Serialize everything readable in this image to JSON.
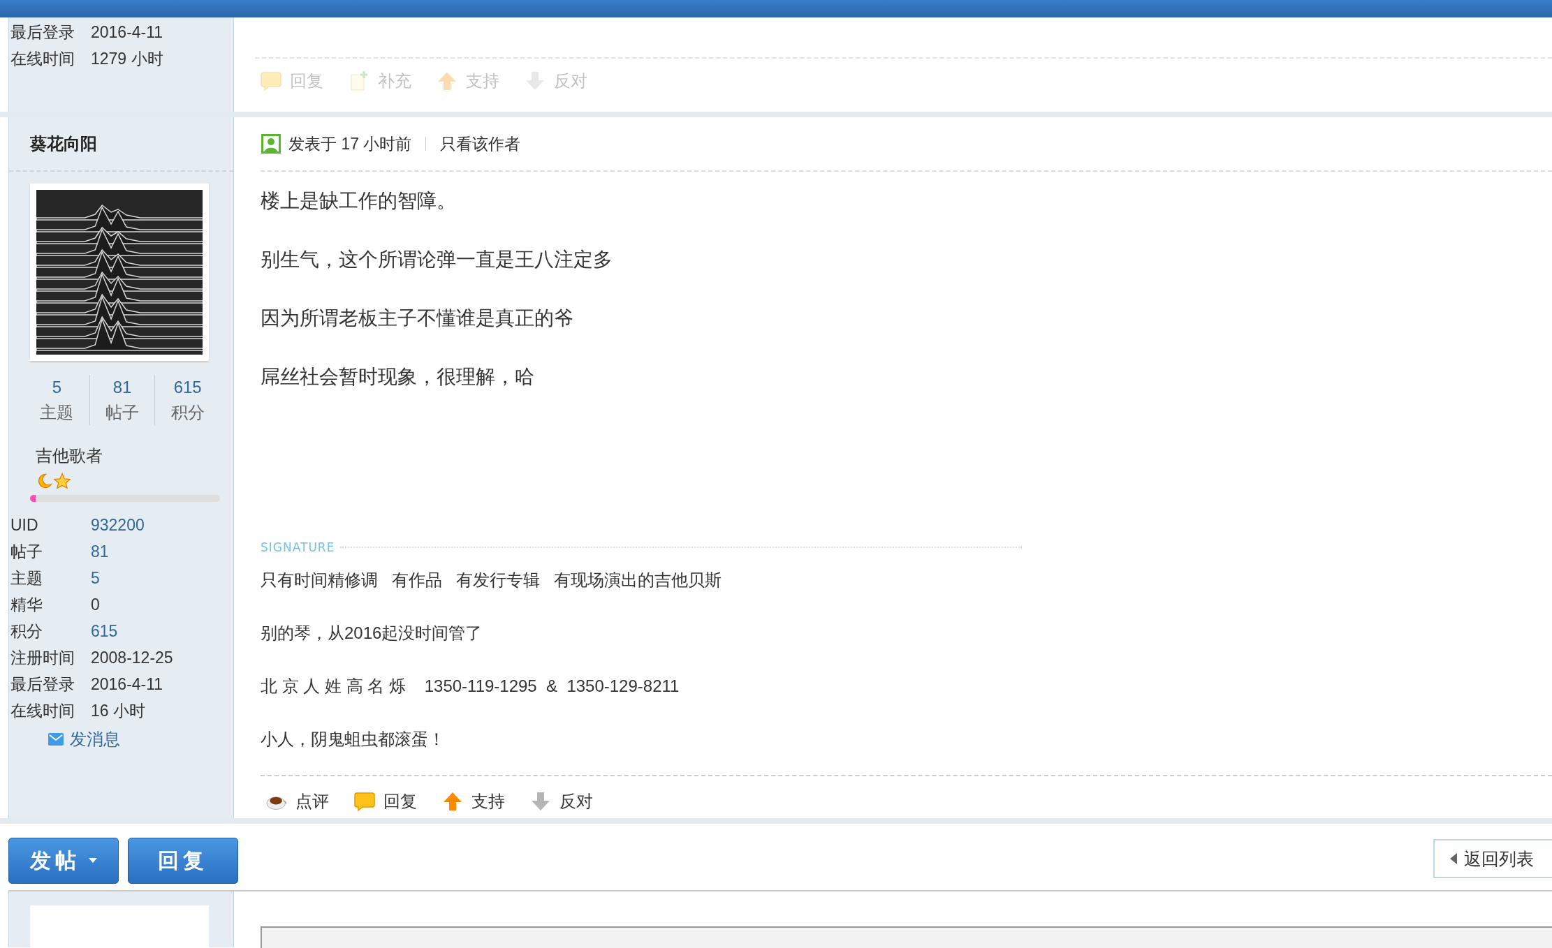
{
  "previous_post": {
    "profile": [
      {
        "label": "最后登录",
        "value": "2016-4-11",
        "link": false
      },
      {
        "label": "在线时间",
        "value": "1279 小时",
        "link": false
      }
    ],
    "actions_disabled": true,
    "actions": [
      {
        "kind": "reply",
        "label": "回复"
      },
      {
        "kind": "add",
        "label": "补充"
      },
      {
        "kind": "support",
        "label": "支持"
      },
      {
        "kind": "oppose",
        "label": "反对"
      }
    ]
  },
  "post": {
    "author": "葵花向阳",
    "counts": [
      {
        "value": "5",
        "label": "主题"
      },
      {
        "value": "81",
        "label": "帖子"
      },
      {
        "value": "615",
        "label": "积分"
      }
    ],
    "rank": "吉他歌者",
    "rank_icons": [
      {
        "kind": "moon"
      },
      {
        "kind": "star"
      }
    ],
    "level": 0.03,
    "profile": [
      {
        "label": "UID",
        "value": "932200",
        "link": true
      },
      {
        "label": "帖子",
        "value": "81",
        "link": true
      },
      {
        "label": "主题",
        "value": "5",
        "link": true
      },
      {
        "label": "精华",
        "value": "0",
        "link": false
      },
      {
        "label": "积分",
        "value": "615",
        "link": true
      },
      {
        "label": "注册时间",
        "value": "2008-12-25",
        "link": false
      },
      {
        "label": "最后登录",
        "value": "2016-4-11",
        "link": false
      },
      {
        "label": "在线时间",
        "value": "16 小时",
        "link": false
      }
    ],
    "message_link": "发消息",
    "time": "发表于 17 小时前",
    "only_author": "只看该作者",
    "body": [
      "楼上是缺工作的智障。",
      "别生气，这个所谓论弹一直是王八注定多",
      "因为所谓老板主子不懂谁是真正的爷",
      "屌丝社会暂时现象，很理解，哈"
    ],
    "signature_label": "SIGNATURE",
    "signature": [
      "只有时间精修调   有作品   有发行专辑   有现场演出的吉他贝斯",
      "别的琴，从2016起没时间管了",
      "北 京 人 姓 高 名 烁    1350-119-1295  &  1350-129-8211",
      "小人，阴鬼蛆虫都滚蛋！"
    ],
    "actions_disabled": false,
    "actions": [
      {
        "kind": "comment",
        "label": "点评"
      },
      {
        "kind": "reply",
        "label": "回复"
      },
      {
        "kind": "support",
        "label": "支持"
      },
      {
        "kind": "oppose",
        "label": "反对"
      }
    ]
  },
  "buttons": [
    {
      "kind": "new_post",
      "label": "发帖"
    },
    {
      "kind": "reply",
      "label": "回复"
    }
  ],
  "back_button": "返回列表"
}
